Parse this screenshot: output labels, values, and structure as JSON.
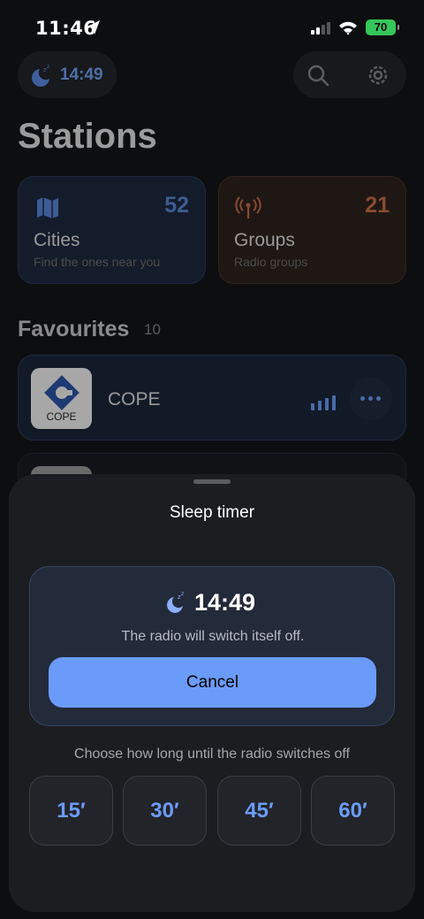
{
  "status_bar": {
    "time": "11:46",
    "battery": "70"
  },
  "header": {
    "sleep_timer_time": "14:49",
    "page_title": "Stations"
  },
  "tiles": [
    {
      "title": "Cities",
      "subtitle": "Find the ones near you",
      "count": "52"
    },
    {
      "title": "Groups",
      "subtitle": "Radio groups",
      "count": "21"
    }
  ],
  "favourites": {
    "title": "Favourites",
    "count": "10",
    "stations": [
      {
        "name": "COPE",
        "logo_text": "COPE"
      }
    ]
  },
  "sheet": {
    "title": "Sleep timer",
    "timer_time": "14:49",
    "description": "The radio will switch itself off.",
    "cancel_label": "Cancel",
    "choose_text": "Choose how long until the radio switches off",
    "options": [
      "15′",
      "30′",
      "45′",
      "60′"
    ]
  },
  "colors": {
    "accent": "#6b9bf9",
    "battery_green": "#35c759",
    "groups_accent": "#8a4a30"
  },
  "icons": [
    "location-arrow-icon",
    "signal-icon",
    "wifi-icon",
    "moon-sleep-icon",
    "search-icon",
    "gear-icon",
    "map-icon",
    "antenna-icon",
    "equalizer-icon",
    "more-icon"
  ]
}
